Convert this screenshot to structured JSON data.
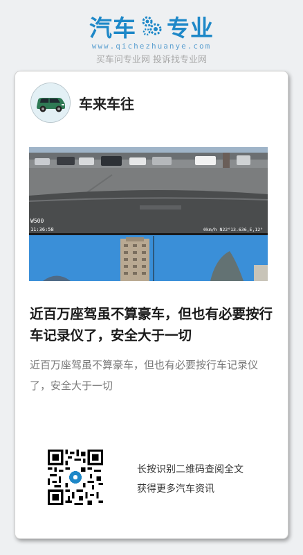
{
  "brand": {
    "name_left": "汽车",
    "name_right": "专业",
    "logo_icon": "gear-icon",
    "domain": "www.qichezhuanye.com",
    "tagline": "买车问专业网 投诉找专业网",
    "color": "#1e88c8"
  },
  "author": {
    "name": "车来车往",
    "avatar_icon": "car-avatar-icon"
  },
  "photo": {
    "top_osd_left": "W500",
    "top_osd_time": "11:36:58",
    "top_osd_right": "0km/h N22°13.636,E,12°",
    "caption_icon": "dashcam-photo"
  },
  "article": {
    "title": "近百万座驾虽不算豪车，但也有必要按行车记录仪了，安全大于一切",
    "summary": "近百万座驾虽不算豪车，但也有必要按行车记录仪了，安全大于一切"
  },
  "share": {
    "qr_icon": "qr-code-icon",
    "hint_line1": "长按识别二维码查阅全文",
    "hint_line2": "获得更多汽车资讯"
  }
}
